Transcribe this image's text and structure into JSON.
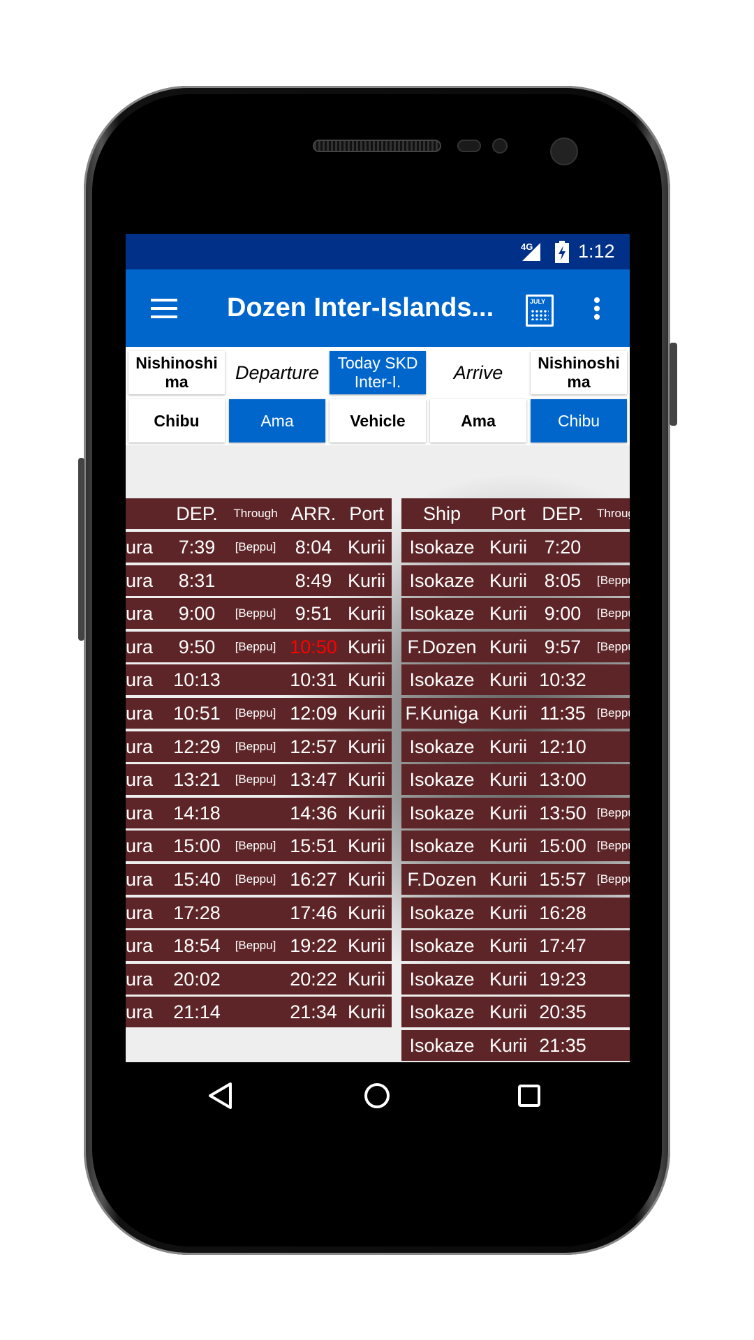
{
  "status_bar": {
    "network": "4G",
    "time": "1:12"
  },
  "app_bar": {
    "title": "Dozen Inter-Islands...",
    "calendar_label": "JULY"
  },
  "selector": {
    "row1": [
      {
        "label": "Nishinoshi ma",
        "selected": false
      },
      {
        "label": "Departure",
        "selected": false
      },
      {
        "label": "Today SKD Inter-I.",
        "selected": true
      },
      {
        "label": "Arrive",
        "selected": false
      },
      {
        "label": "Nishinoshi ma",
        "selected": false
      }
    ],
    "row2": [
      {
        "label": "Chibu",
        "selected": false
      },
      {
        "label": "Ama",
        "selected": true
      },
      {
        "label": "Vehicle",
        "selected": false
      },
      {
        "label": "Ama",
        "selected": false
      },
      {
        "label": "Chibu",
        "selected": true
      }
    ]
  },
  "left_table": {
    "headers": {
      "port": "Port",
      "dep": "DEP.",
      "through": "Through",
      "arr": "ARR.",
      "arr_port": "Port"
    },
    "rows": [
      {
        "port": "Hishiura",
        "dep": "7:39",
        "through": "[Beppu]",
        "arr": "8:04",
        "arr_port": "Kurii"
      },
      {
        "port": "Hishiura",
        "dep": "8:31",
        "through": "",
        "arr": "8:49",
        "arr_port": "Kurii"
      },
      {
        "port": "Hishiura",
        "dep": "9:00",
        "through": "[Beppu]",
        "arr": "9:51",
        "arr_port": "Kurii"
      },
      {
        "port": "Hishiura",
        "dep": "9:50",
        "through": "[Beppu]",
        "arr": "10:50",
        "arr_port": "Kurii",
        "highlight": "#ff0000"
      },
      {
        "port": "Hishiura",
        "dep": "10:13",
        "through": "",
        "arr": "10:31",
        "arr_port": "Kurii"
      },
      {
        "port": "Hishiura",
        "dep": "10:51",
        "through": "[Beppu]",
        "arr": "12:09",
        "arr_port": "Kurii"
      },
      {
        "port": "Hishiura",
        "dep": "12:29",
        "through": "[Beppu]",
        "arr": "12:57",
        "arr_port": "Kurii"
      },
      {
        "port": "Hishiura",
        "dep": "13:21",
        "through": "[Beppu]",
        "arr": "13:47",
        "arr_port": "Kurii"
      },
      {
        "port": "Hishiura",
        "dep": "14:18",
        "through": "",
        "arr": "14:36",
        "arr_port": "Kurii"
      },
      {
        "port": "Hishiura",
        "dep": "15:00",
        "through": "[Beppu]",
        "arr": "15:51",
        "arr_port": "Kurii"
      },
      {
        "port": "Hishiura",
        "dep": "15:40",
        "through": "[Beppu]",
        "arr": "16:27",
        "arr_port": "Kurii"
      },
      {
        "port": "Hishiura",
        "dep": "17:28",
        "through": "",
        "arr": "17:46",
        "arr_port": "Kurii"
      },
      {
        "port": "Hishiura",
        "dep": "18:54",
        "through": "[Beppu]",
        "arr": "19:22",
        "arr_port": "Kurii"
      },
      {
        "port": "Hishiura",
        "dep": "20:02",
        "through": "",
        "arr": "20:22",
        "arr_port": "Kurii"
      },
      {
        "port": "Hishiura",
        "dep": "21:14",
        "through": "",
        "arr": "21:34",
        "arr_port": "Kurii"
      }
    ]
  },
  "right_table": {
    "headers": {
      "ship": "Ship",
      "port": "Port",
      "dep": "DEP.",
      "through": "Through"
    },
    "rows": [
      {
        "ship": "Isokaze",
        "port": "Kurii",
        "dep": "7:20",
        "through": ""
      },
      {
        "ship": "Isokaze",
        "port": "Kurii",
        "dep": "8:05",
        "through": "[Beppu]"
      },
      {
        "ship": "Isokaze",
        "port": "Kurii",
        "dep": "9:00",
        "through": "[Beppu]"
      },
      {
        "ship": "F.Dozen",
        "port": "Kurii",
        "dep": "9:57",
        "through": "[Beppu]"
      },
      {
        "ship": "Isokaze",
        "port": "Kurii",
        "dep": "10:32",
        "through": ""
      },
      {
        "ship": "F.Kuniga",
        "port": "Kurii",
        "dep": "11:35",
        "through": "[Beppu]"
      },
      {
        "ship": "Isokaze",
        "port": "Kurii",
        "dep": "12:10",
        "through": ""
      },
      {
        "ship": "Isokaze",
        "port": "Kurii",
        "dep": "13:00",
        "through": ""
      },
      {
        "ship": "Isokaze",
        "port": "Kurii",
        "dep": "13:50",
        "through": "[Beppu]"
      },
      {
        "ship": "Isokaze",
        "port": "Kurii",
        "dep": "15:00",
        "through": "[Beppu]"
      },
      {
        "ship": "F.Dozen",
        "port": "Kurii",
        "dep": "15:57",
        "through": "[Beppu]"
      },
      {
        "ship": "Isokaze",
        "port": "Kurii",
        "dep": "16:28",
        "through": ""
      },
      {
        "ship": "Isokaze",
        "port": "Kurii",
        "dep": "17:47",
        "through": ""
      },
      {
        "ship": "Isokaze",
        "port": "Kurii",
        "dep": "19:23",
        "through": ""
      },
      {
        "ship": "Isokaze",
        "port": "Kurii",
        "dep": "20:35",
        "through": ""
      },
      {
        "ship": "Isokaze",
        "port": "Kurii",
        "dep": "21:35",
        "through": ""
      }
    ]
  }
}
